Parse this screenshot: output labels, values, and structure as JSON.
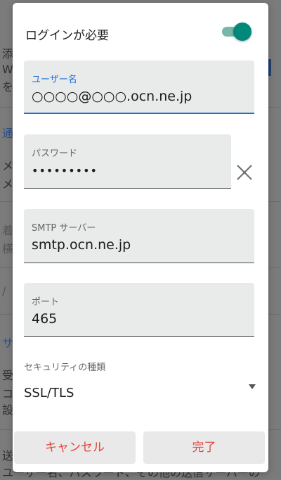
{
  "background": {
    "fragments": [
      {
        "key": "a",
        "text": "添"
      },
      {
        "key": "b",
        "text": "W"
      },
      {
        "key": "c",
        "text": "を"
      },
      {
        "key": "d",
        "text": "通"
      },
      {
        "key": "e",
        "text": "メ"
      },
      {
        "key": "f",
        "text": "メ"
      },
      {
        "key": "g",
        "text": "着"
      },
      {
        "key": "h",
        "text": "横"
      },
      {
        "key": "i",
        "text": "/"
      },
      {
        "key": "j",
        "text": "サ"
      },
      {
        "key": "k",
        "text": "受"
      },
      {
        "key": "l",
        "text": "コ"
      },
      {
        "key": "m",
        "text": "設"
      },
      {
        "key": "n",
        "text": "送"
      },
      {
        "key": "o",
        "text": "ユーザー名、パスワード、その他の送信サーバーの"
      }
    ],
    "accent_color": "#1f3f75"
  },
  "dialog": {
    "title": "ログインが必要",
    "login_toggle_on": true,
    "fields": [
      {
        "label": "ユーザー名",
        "value": "○○○○@○○○.ocn.ne.jp",
        "active": true
      },
      {
        "label": "パスワード",
        "value": "•••••••••",
        "active": false
      },
      {
        "label": "SMTP サーバー",
        "value": "smtp.ocn.ne.jp",
        "active": false
      },
      {
        "label": "ポート",
        "value": "465",
        "active": false
      }
    ],
    "security": {
      "label": "セキュリティの種類",
      "selected": "SSL/TLS"
    },
    "buttons": {
      "cancel": "キャンセル",
      "done": "完了"
    }
  },
  "colors": {
    "toggle_on": "#00897b",
    "toggle_track": "#76b7a8",
    "active_field": "#1f6fd6",
    "button_text": "#e2473d"
  },
  "icons": {
    "clear": "close-icon",
    "dropdown": "dropdown-arrow-icon"
  }
}
